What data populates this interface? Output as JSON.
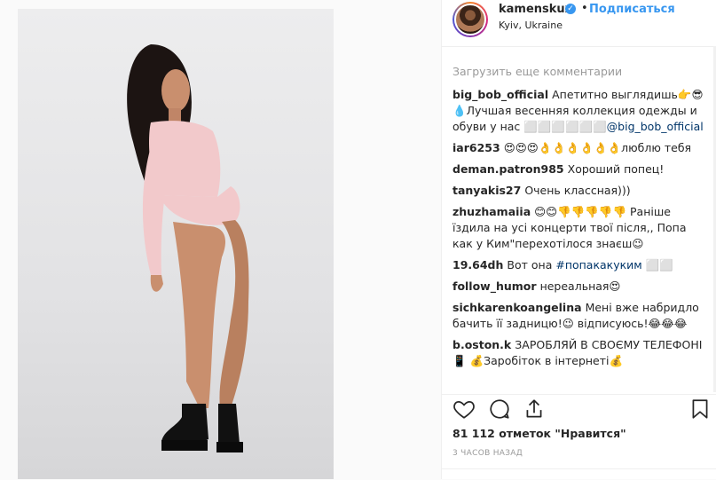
{
  "post": {
    "username": "kamenskux",
    "follow_label": "Подписаться",
    "location": "Kyiv, Ukraine",
    "dot": "•",
    "verified_mark": "✓"
  },
  "comments": {
    "load_more": "Загрузить еще комментарии",
    "items": [
      {
        "user": "big_bob_official",
        "text": "Апетитно выглядишь👉😎 💧Лучшая весенняя коллекция одежды и обуви у нас ⬜⬜⬜⬜⬜⬜",
        "link": "@big_bob_official",
        "after": ""
      },
      {
        "user": "iar6253",
        "text": "😍😍😍👌👌👌👌👌👌люблю тебя",
        "link": "",
        "after": ""
      },
      {
        "user": "deman.patron985",
        "text": "Хороший попец!",
        "link": "",
        "after": ""
      },
      {
        "user": "tanyakis27",
        "text": "Очень классная)))",
        "link": "",
        "after": ""
      },
      {
        "user": "zhuzhamaiia",
        "text": "😊😊👎👎👎👎👎 Раніше їздила на усі концерти твої після,, Попа как у Ким\"перехотілося знаєш😉",
        "link": "",
        "after": ""
      },
      {
        "user": "19.64dh",
        "text": "Вот она",
        "link": "#попакакуким",
        "after": "⬜⬜"
      },
      {
        "user": "follow_humor",
        "text": "нереальная😍",
        "link": "",
        "after": ""
      },
      {
        "user": "sichkarenkoangelina",
        "text": "Мені вже набридло бачить її задницю!😉 відписуюсь!😂😂😂",
        "link": "",
        "after": ""
      },
      {
        "user": "b.oston.k",
        "text": "ЗАРОБЛЯЙ В СВОЄМУ ТЕЛЕФОНІ📱 💰Заробіток в інтернеті💰",
        "link": "",
        "after": ""
      }
    ]
  },
  "footer": {
    "likes": "81 112 отметок \"Нравится\"",
    "timestamp": "3 ЧАСОВ НАЗАД"
  },
  "icons": {
    "like": "heart-icon",
    "comment": "comment-bubble-icon",
    "share": "share-icon",
    "save": "bookmark-icon"
  }
}
